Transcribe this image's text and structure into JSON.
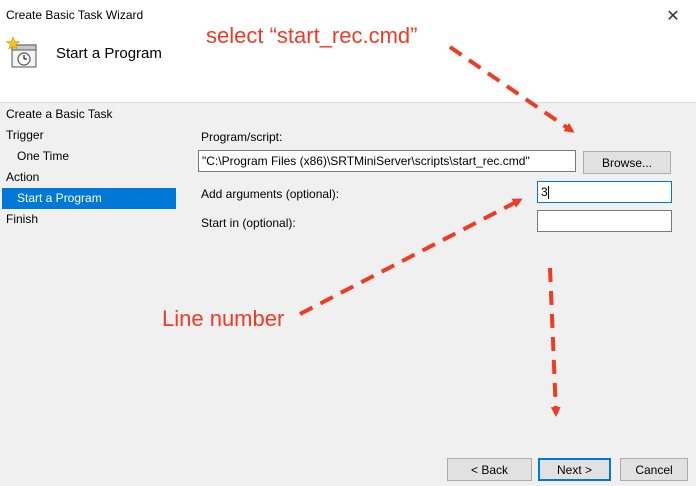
{
  "window": {
    "title": "Create Basic Task Wizard",
    "close_glyph": "✕"
  },
  "header": {
    "heading": "Start a Program",
    "icon": "task-scheduler-icon"
  },
  "steps": [
    {
      "label": "Create a Basic Task"
    },
    {
      "label": "Trigger"
    },
    {
      "label": "One Time"
    },
    {
      "label": "Action"
    },
    {
      "label": "Start a Program"
    },
    {
      "label": "Finish"
    }
  ],
  "form": {
    "program_label": "Program/script:",
    "program_value": "\"C:\\Program Files (x86)\\SRTMiniServer\\scripts\\start_rec.cmd\"",
    "browse_label": "Browse...",
    "args_label": "Add arguments (optional):",
    "args_value": "3",
    "startin_label": "Start in (optional):",
    "startin_value": ""
  },
  "buttons": {
    "back": "< Back",
    "next": "Next >",
    "cancel": "Cancel"
  },
  "annotations": {
    "select_note": "select “start_rec.cmd”",
    "line_note": "Line number",
    "color": "#ef3b24"
  }
}
